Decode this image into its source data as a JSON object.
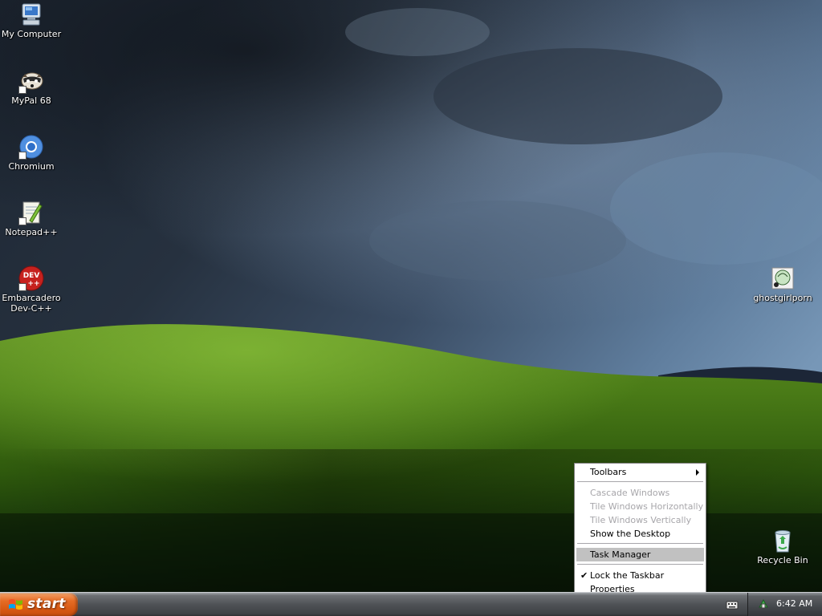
{
  "desktop": {
    "icons_left": [
      {
        "label": "My Computer"
      },
      {
        "label": "MyPal 68"
      },
      {
        "label": "Chromium"
      },
      {
        "label": "Notepad++"
      },
      {
        "label": "Embarcadero Dev-C++"
      }
    ],
    "icons_right": [
      {
        "label": "ghostgirlporn"
      },
      {
        "label": "Recycle Bin"
      }
    ]
  },
  "context_menu": {
    "items": [
      {
        "label": "Toolbars",
        "submenu": true
      },
      {
        "label": "Cascade Windows",
        "disabled": true
      },
      {
        "label": "Tile Windows Horizontally",
        "disabled": true
      },
      {
        "label": "Tile Windows Vertically",
        "disabled": true
      },
      {
        "label": "Show the Desktop"
      },
      {
        "label": "Task Manager",
        "highlighted": true
      },
      {
        "label": "Lock the Taskbar",
        "checked": true
      },
      {
        "label": "Properties"
      }
    ]
  },
  "taskbar": {
    "start_label": "start",
    "clock": "6:42 AM"
  },
  "colors": {
    "start_orange": "#e56c25",
    "menu_highlight": "#c1c1c1",
    "menu_disabled_text": "#a7a6aa"
  }
}
